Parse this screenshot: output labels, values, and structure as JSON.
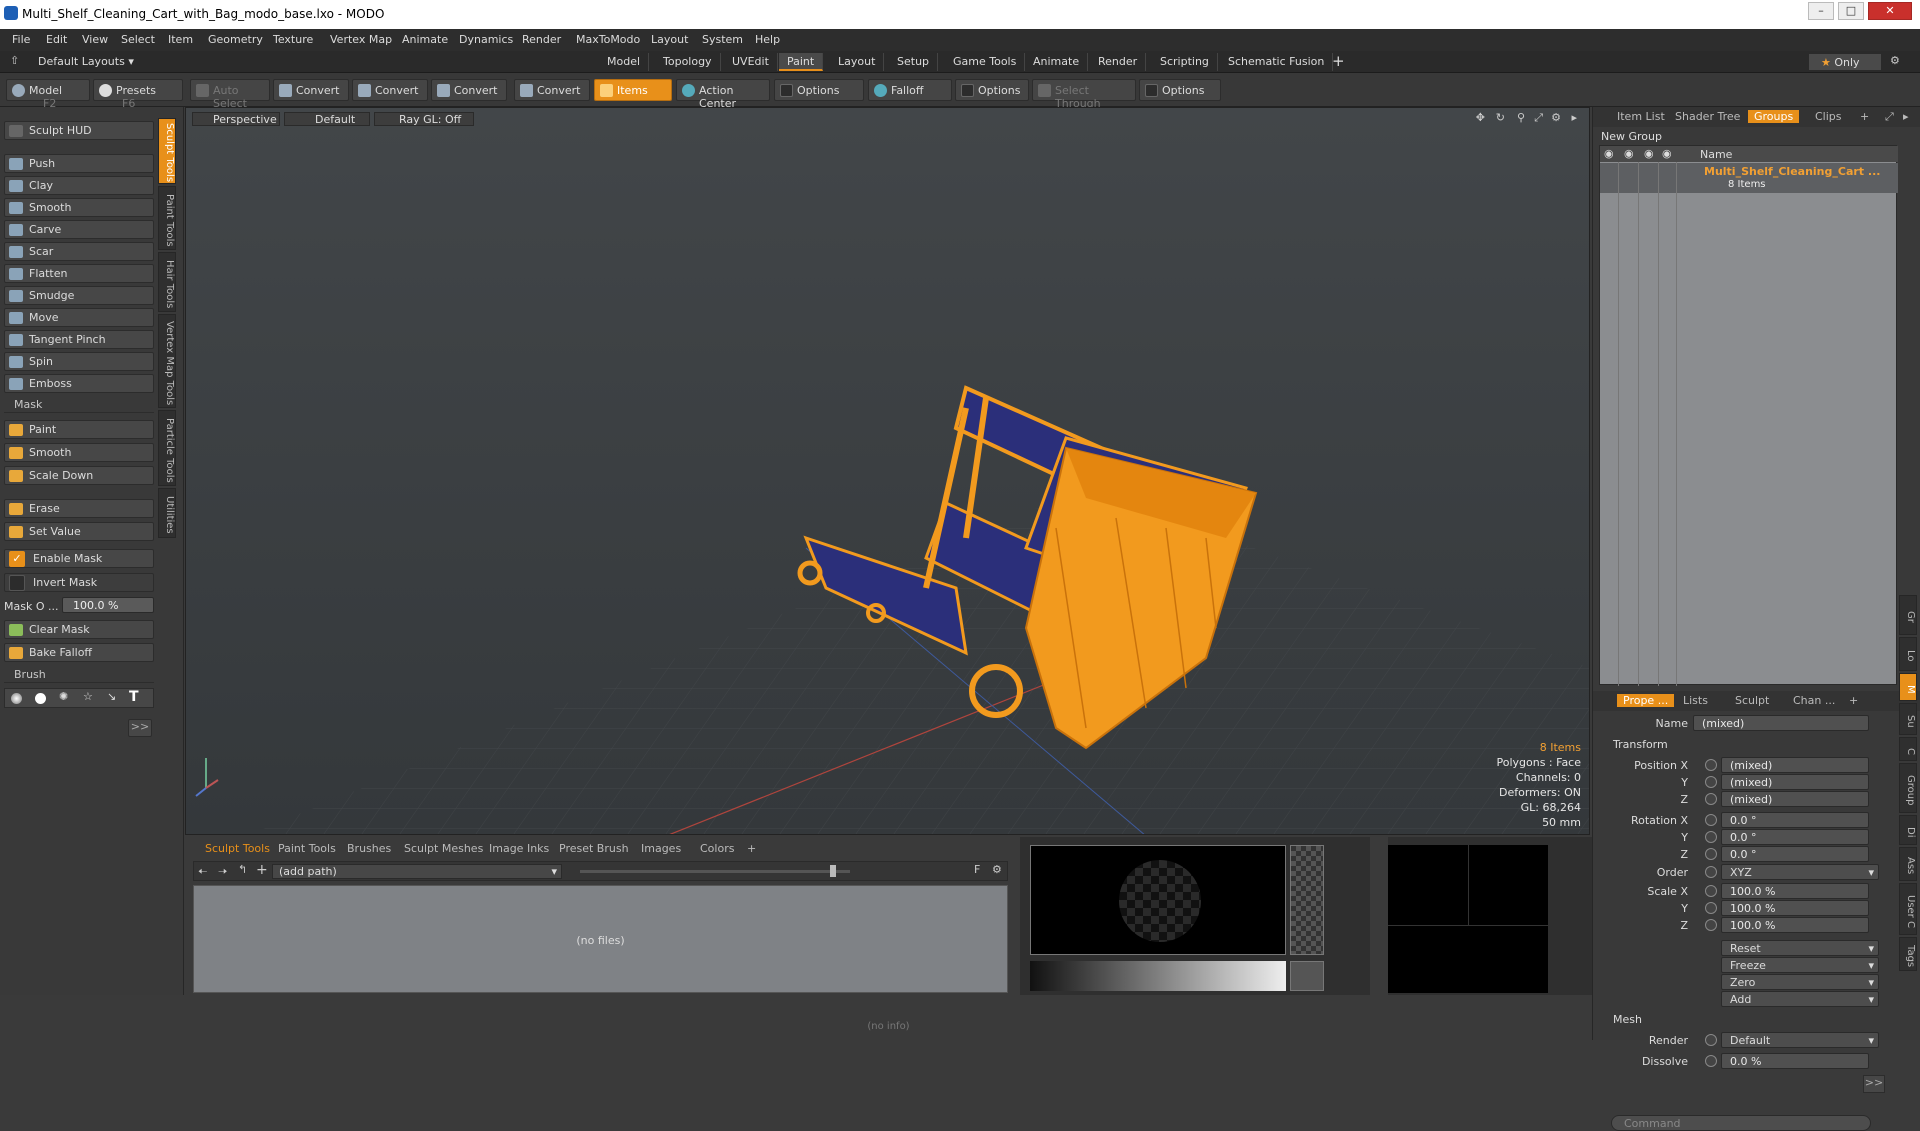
{
  "window": {
    "title": "Multi_Shelf_Cleaning_Cart_with_Bag_modo_base.lxo - MODO"
  },
  "menubar": [
    "File",
    "Edit",
    "View",
    "Select",
    "Item",
    "Geometry",
    "Texture",
    "Vertex Map",
    "Animate",
    "Dynamics",
    "Render",
    "MaxToModo",
    "Layout",
    "System",
    "Help"
  ],
  "layoutbar": {
    "layouts_label": "Default Layouts",
    "tabs": [
      "Model",
      "Topology",
      "UVEdit",
      "Paint",
      "Layout",
      "Setup",
      "Game Tools",
      "Animate",
      "Render",
      "Scripting",
      "Schematic Fusion"
    ],
    "active_tab": "Paint",
    "only_label": "Only"
  },
  "toolbar": {
    "model": "Model",
    "model_key": "F2",
    "presets": "Presets",
    "presets_key": "F6",
    "auto_select": "Auto Select",
    "convert1": "Convert",
    "convert2": "Convert",
    "convert3": "Convert",
    "convert4": "Convert",
    "items": "Items",
    "action_center": "Action Center",
    "options1": "Options",
    "falloff": "Falloff",
    "options2": "Options",
    "select_through": "Select Through",
    "options3": "Options"
  },
  "left_panel": {
    "sculpt_hud": "Sculpt HUD",
    "tools": [
      "Push",
      "Clay",
      "Smooth",
      "Carve",
      "Scar",
      "Flatten",
      "Smudge",
      "Move",
      "Tangent Pinch",
      "Spin",
      "Emboss"
    ],
    "mask_section": "Mask",
    "mask_tools": [
      "Paint",
      "Smooth",
      "Scale Down"
    ],
    "erase": "Erase",
    "set_value": "Set Value",
    "enable_mask": "Enable Mask",
    "invert_mask": "Invert Mask",
    "mask_opacity_label": "Mask O ...",
    "mask_opacity_value": "100.0 %",
    "clear_mask": "Clear Mask",
    "bake_falloff": "Bake Falloff",
    "brush_section": "Brush",
    "more": ">>"
  },
  "vertical_tabs": [
    "Sculpt Tools",
    "Paint Tools",
    "Hair Tools",
    "Vertex Map Tools",
    "Particle Tools",
    "Utilities"
  ],
  "viewport": {
    "view": "Perspective",
    "style": "Default",
    "raygl": "Ray GL: Off",
    "hud": {
      "items": "8 Items",
      "polygons": "Polygons : Face",
      "channels": "Channels: 0",
      "deformers": "Deformers: ON",
      "gl": "GL: 68,264",
      "scale": "50 mm"
    }
  },
  "bottom_panel": {
    "tabs": [
      "Sculpt Tools",
      "Paint Tools",
      "Brushes",
      "Sculpt Meshes",
      "Image Inks",
      "Preset Brush",
      "Images",
      "Colors"
    ],
    "active_tab": "Sculpt Tools",
    "path": "(add path)",
    "files": "(no files)",
    "f_button": "F"
  },
  "right_panel": {
    "tabs": [
      "Item List",
      "Shader Tree",
      "Groups",
      "Clips"
    ],
    "active_tab": "Groups",
    "new_group": "New Group",
    "col_name": "Name",
    "group_name": "Multi_Shelf_Cleaning_Cart ...",
    "group_count": "8 Items",
    "prop_tabs": [
      "Prope ...",
      "Lists",
      "Sculpt",
      "Chan ..."
    ],
    "name_label": "Name",
    "name_value": "(mixed)",
    "transform": "Transform",
    "position_x": "Position X",
    "y": "Y",
    "z": "Z",
    "pos_values": [
      "(mixed)",
      "(mixed)",
      "(mixed)"
    ],
    "rotation_x": "Rotation X",
    "rot_values": [
      "0.0 °",
      "0.0 °",
      "0.0 °"
    ],
    "order_label": "Order",
    "order_value": "XYZ",
    "scale_x": "Scale X",
    "scale_values": [
      "100.0 %",
      "100.0 %",
      "100.0 %"
    ],
    "actions": [
      "Reset",
      "Freeze",
      "Zero",
      "Add"
    ],
    "mesh": "Mesh",
    "render_label": "Render",
    "render_value": "Default",
    "dissolve_label": "Dissolve",
    "dissolve_value": "0.0 %",
    "more": ">>",
    "command_placeholder": "Command"
  },
  "right_vtabs": [
    "Gr",
    "Lo",
    "M",
    "Su",
    "C",
    "Group",
    "Di",
    "Ass",
    "User C",
    "Tags"
  ],
  "status": "(no info)"
}
